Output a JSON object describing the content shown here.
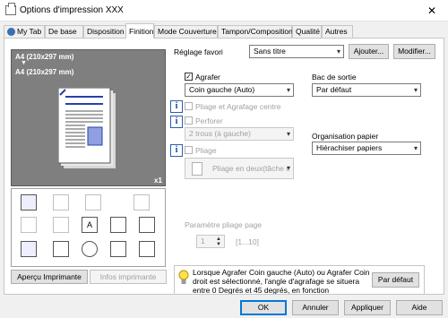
{
  "window": {
    "title": "Options d'impression XXX",
    "close": "✕"
  },
  "tabs": [
    {
      "label": "My Tab"
    },
    {
      "label": "De base"
    },
    {
      "label": "Disposition"
    },
    {
      "label": "Finition"
    },
    {
      "label": "Mode Couverture"
    },
    {
      "label": "Tampon/Composition"
    },
    {
      "label": "Qualité"
    },
    {
      "label": "Autres"
    }
  ],
  "preview": {
    "paper_line1": "A4 (210x297 mm)",
    "arrow": "▼",
    "paper_line2": "A4 (210x297 mm)",
    "copies": "x1"
  },
  "left_buttons": {
    "printer_view": "Aperçu Imprimante",
    "printer_info": "Infos imprimante"
  },
  "favorite": {
    "label": "Réglage favori",
    "value": "Sans titre",
    "add": "Ajouter...",
    "modify": "Modifier..."
  },
  "staple": {
    "label": "Agrafer",
    "checked": "✓",
    "value": "Coin gauche (Auto)"
  },
  "fold_staple": {
    "label": "Pliage et Agrafage centre"
  },
  "punch": {
    "label": "Perforer",
    "value": "2 trous (à gauche)"
  },
  "fold": {
    "label": "Pliage",
    "value": "Pliage en deux(tâche c"
  },
  "fold_param": {
    "label": "Paramètre pliage page",
    "value": "1",
    "range": "[1...10]"
  },
  "output_tray": {
    "label": "Bac de sortie",
    "value": "Par défaut"
  },
  "paper_arrangement": {
    "label": "Organisation papier",
    "value": "Hiérachiser papiers"
  },
  "message": {
    "text": "Lorsque Agrafer Coin gauche (Auto) ou Agrafer Coin droit est sélectionné, l'angle d'agrafage se situera entre 0 Degrés et 45 degrés, en fonction",
    "default": "Par défaut"
  },
  "footer": {
    "ok": "OK",
    "cancel": "Annuler",
    "apply": "Appliquer",
    "help": "Aide"
  },
  "colors": {
    "accent": "#0078d7",
    "preview_bg": "#7f7f7f",
    "staple": "#2b3fa8"
  }
}
